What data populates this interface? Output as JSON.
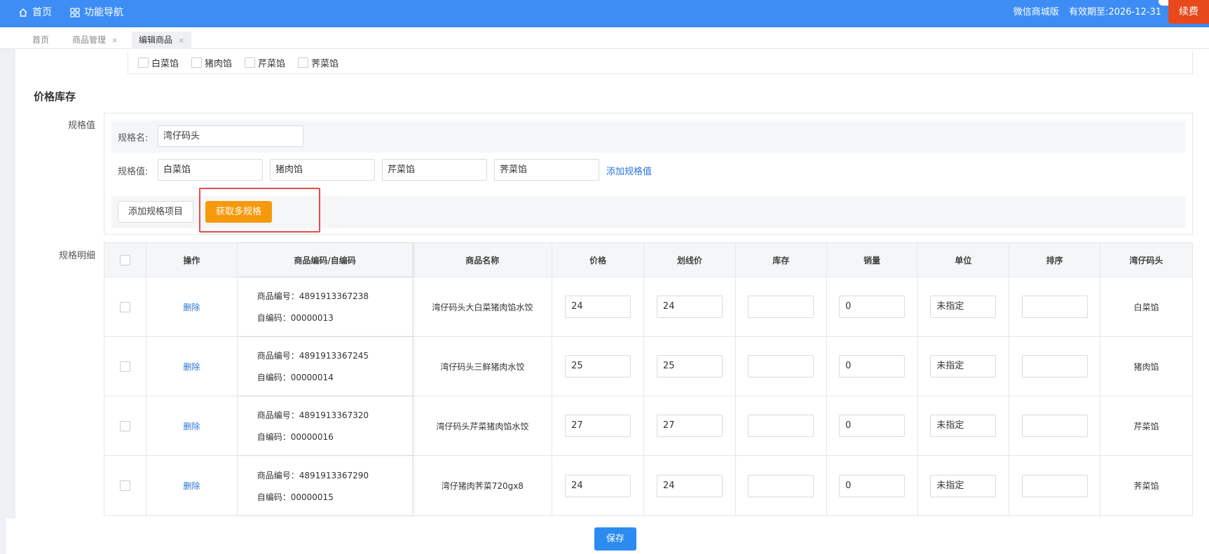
{
  "topbar": {
    "home": "首页",
    "nav": "功能导航",
    "edition": "微信商城版",
    "expiry": "有效期至:2026-12-31",
    "renew": "续费"
  },
  "tabs": [
    {
      "label": "首页"
    },
    {
      "label": "商品管理",
      "close": "×"
    },
    {
      "label": "编辑商品",
      "close": "×"
    }
  ],
  "prev_options": [
    "白菜馅",
    "猪肉馅",
    "芹菜馅",
    "荠菜馅"
  ],
  "section_title": "价格库存",
  "spec": {
    "side_label": "规格值",
    "name_label": "规格名:",
    "name_value": "湾仔码头",
    "values_label": "规格值:",
    "values": [
      "白菜馅",
      "猪肉馅",
      "芹菜馅",
      "荠菜馅"
    ],
    "add_value": "添加规格值",
    "add_item": "添加规格项目",
    "get_multi": "获取多规格"
  },
  "detail_label": "规格明细",
  "table": {
    "headers": [
      "操作",
      "商品编码/自编码",
      "商品名称",
      "价格",
      "划线价",
      "库存",
      "销量",
      "单位",
      "排序",
      "湾仔码头"
    ],
    "rows": [
      {
        "action": "删除",
        "code": "商品编号：4891913367238",
        "self_code": "自编码：00000013",
        "name": "湾仔码头大白菜猪肉馅水饺",
        "price": "24",
        "strike": "24",
        "stock": "",
        "sales": "0",
        "unit": "未指定",
        "sort": "",
        "spec": "白菜馅"
      },
      {
        "action": "删除",
        "code": "商品编号：4891913367245",
        "self_code": "自编码：00000014",
        "name": "湾仔码头三鲜猪肉水饺",
        "price": "25",
        "strike": "25",
        "stock": "",
        "sales": "0",
        "unit": "未指定",
        "sort": "",
        "spec": "猪肉馅"
      },
      {
        "action": "删除",
        "code": "商品编号：4891913367320",
        "self_code": "自编码：00000016",
        "name": "湾仔码头芹菜猪肉馅水饺",
        "price": "27",
        "strike": "27",
        "stock": "",
        "sales": "0",
        "unit": "未指定",
        "sort": "",
        "spec": "芹菜馅"
      },
      {
        "action": "删除",
        "code": "商品编号：4891913367290",
        "self_code": "自编码：00000015",
        "name": "湾仔猪肉荠菜720gx8",
        "price": "24",
        "strike": "24",
        "stock": "",
        "sales": "0",
        "unit": "未指定",
        "sort": "",
        "spec": "荠菜馅"
      }
    ]
  },
  "save": "保存",
  "colors": {
    "topbar": "#3d8df5",
    "renew": "#e8491c",
    "orange": "#f59a0c",
    "link": "#2a73d9",
    "highlight": "#e84b4b"
  }
}
